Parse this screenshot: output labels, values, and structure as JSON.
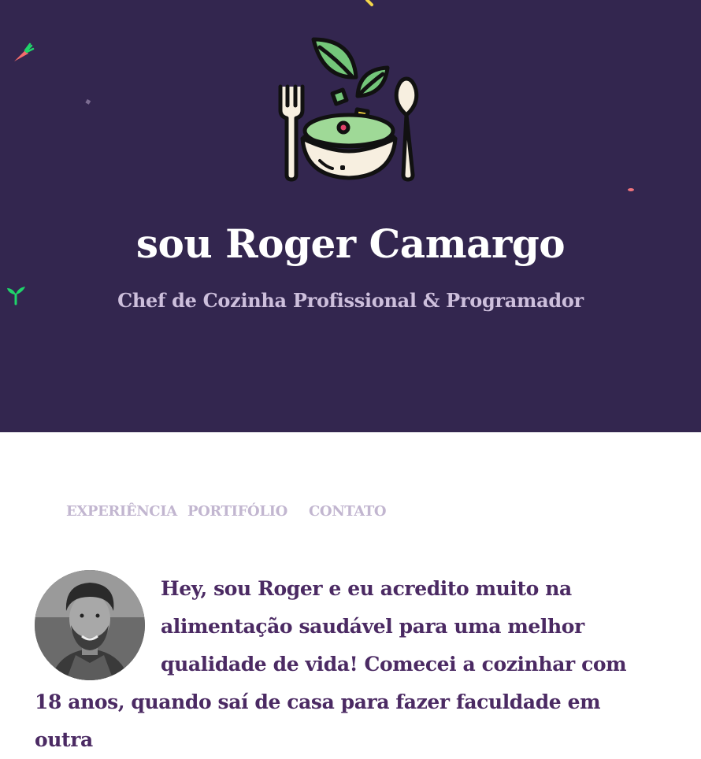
{
  "hero": {
    "title": "sou Roger Camargo",
    "subtitle": "Chef de Cozinha Profissional & Programador",
    "background_color": "#33264f",
    "logo_icon": "salad-bowl-icon"
  },
  "nav": {
    "items": [
      {
        "label": "EXPERIÊNCIA"
      },
      {
        "label": "PORTIFÓLIO"
      },
      {
        "label": "CONTATO"
      }
    ],
    "color": "#c2b6d0"
  },
  "intro": {
    "avatar_icon": "avatar-photo",
    "text": "Hey, sou Roger e eu acredito muito na alimentação saudável para uma melhor qualidade de vida! Comecei a cozinhar com 18 anos, quando saí de casa para fazer faculdade em outra",
    "text_color": "#4b2a63"
  }
}
